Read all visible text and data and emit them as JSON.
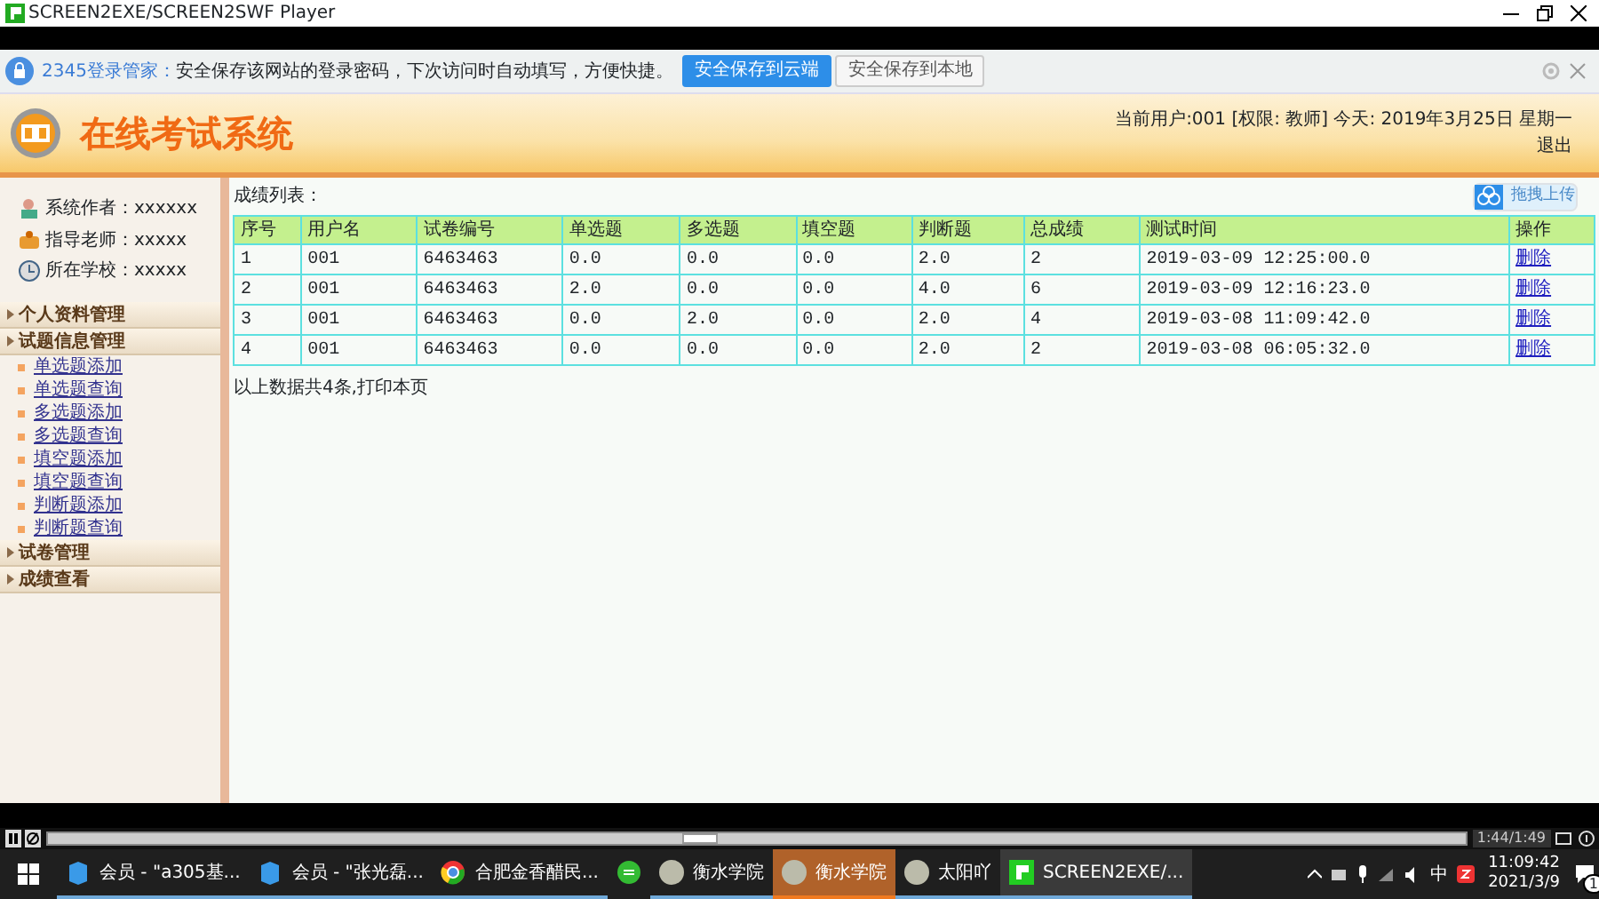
{
  "window": {
    "title": "SCREEN2EXE/SCREEN2SWF Player"
  },
  "password_bar": {
    "brand": "2345登录管家：",
    "message": "安全保存该网站的登录密码，下次访问时自动填写，方便快捷。",
    "buttons": [
      {
        "label": "安全保存到云端",
        "primary": true
      },
      {
        "label": "安全保存到本地",
        "primary": false
      }
    ]
  },
  "header": {
    "title": "在线考试系统",
    "user_info": "当前用户:001 [权限: 教师] 今天: 2019年3月25日 星期一",
    "logout": "退出"
  },
  "sidebar": {
    "info": [
      {
        "kind": "author",
        "text": "系统作者：xxxxxx"
      },
      {
        "kind": "teacher",
        "text": "指导老师：xxxxx"
      },
      {
        "kind": "school",
        "text": "所在学校：xxxxx"
      }
    ],
    "menu": [
      {
        "label": "个人资料管理"
      },
      {
        "label": "试题信息管理",
        "children": [
          {
            "label": "单选题添加"
          },
          {
            "label": "单选题查询"
          },
          {
            "label": "多选题添加"
          },
          {
            "label": "多选题查询"
          },
          {
            "label": "填空题添加"
          },
          {
            "label": "填空题查询"
          },
          {
            "label": "判断题添加"
          },
          {
            "label": "判断题查询"
          }
        ]
      },
      {
        "label": "试卷管理"
      },
      {
        "label": "成绩查看"
      }
    ]
  },
  "content": {
    "title": "成绩列表：",
    "upload_button": "拖拽上传",
    "table": {
      "columns": [
        "序号",
        "用户名",
        "试卷编号",
        "单选题",
        "多选题",
        "填空题",
        "判断题",
        "总成绩",
        "测试时间",
        "操作"
      ],
      "rows": [
        [
          "1",
          "001",
          "6463463",
          "0.0",
          "0.0",
          "0.0",
          "2.0",
          "2",
          "2019-03-09 12:25:00.0",
          "删除"
        ],
        [
          "2",
          "001",
          "6463463",
          "2.0",
          "0.0",
          "0.0",
          "4.0",
          "6",
          "2019-03-09 12:16:23.0",
          "删除"
        ],
        [
          "3",
          "001",
          "6463463",
          "0.0",
          "2.0",
          "0.0",
          "2.0",
          "4",
          "2019-03-08 11:09:42.0",
          "删除"
        ],
        [
          "4",
          "001",
          "6463463",
          "0.0",
          "0.0",
          "0.0",
          "2.0",
          "2",
          "2019-03-08 06:05:32.0",
          "删除"
        ]
      ]
    },
    "footer": "以上数据共4条,打印本页"
  },
  "player": {
    "level": 0.46,
    "time": "1:44/1:49"
  },
  "taskbar": {
    "items": [
      {
        "kind": "doc",
        "label": "会员 - \"a305基...",
        "flashing": false,
        "selected": false
      },
      {
        "kind": "doc",
        "label": "会员 - \"张光磊...",
        "flashing": false,
        "selected": false
      },
      {
        "kind": "browser",
        "label": "合肥金香醋民...",
        "flashing": false,
        "selected": false
      },
      {
        "kind": "app",
        "flashing": false,
        "selected": false
      },
      {
        "kind": "avatar",
        "label": "衡水学院",
        "flashing": false,
        "selected": false
      },
      {
        "kind": "avatar",
        "label": "衡水学院",
        "flashing": true,
        "selected": false
      },
      {
        "kind": "avatar",
        "label": "太阳吖",
        "flashing": false,
        "selected": false
      },
      {
        "kind": "player",
        "label": "SCREEN2EXE/...",
        "flashing": false,
        "selected": true
      }
    ],
    "ime": "中",
    "time": "11:09:42",
    "date": "2021/3/9",
    "notifications": "1"
  }
}
